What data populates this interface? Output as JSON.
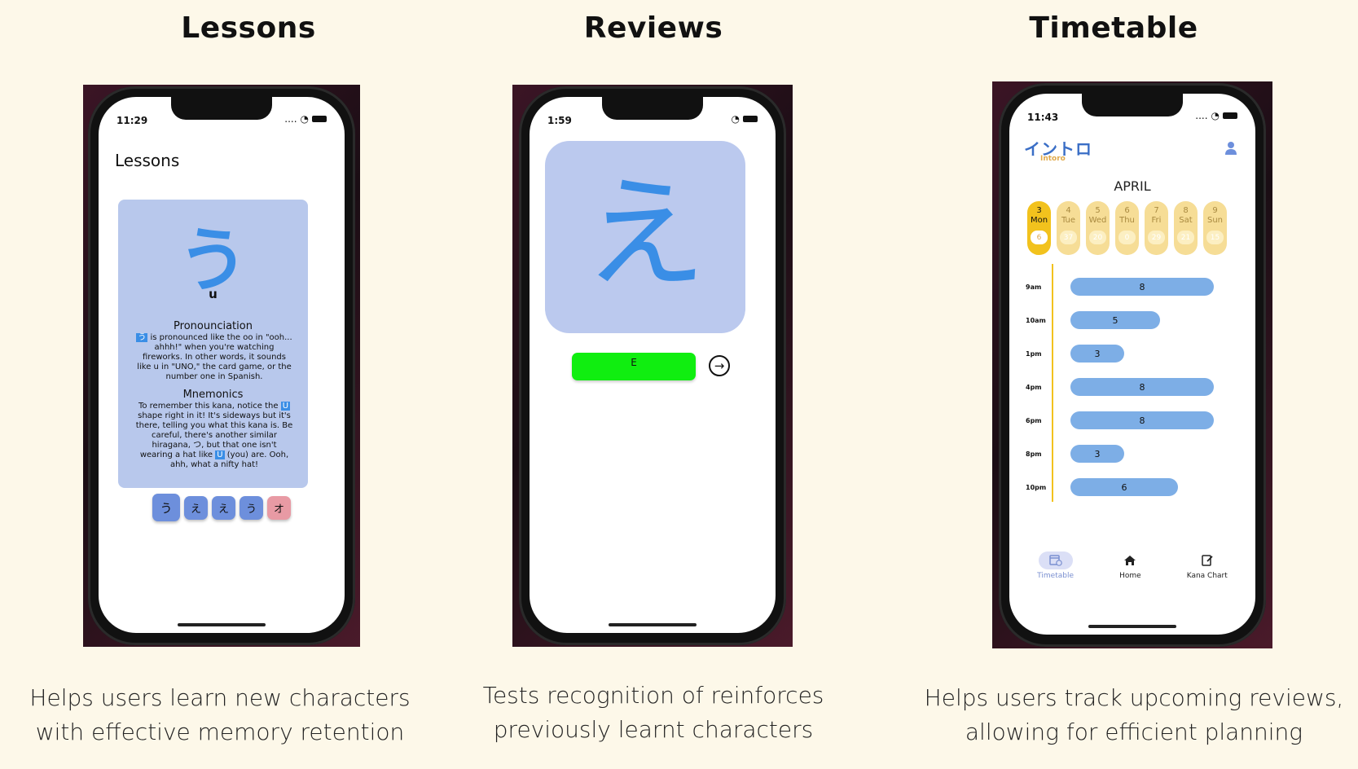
{
  "sections": [
    {
      "title": "Lessons",
      "caption_line1": "Helps users learn new characters",
      "caption_line2": "with effective memory retention"
    },
    {
      "title": "Reviews",
      "caption_line1": "Tests recognition of reinforces",
      "caption_line2": "previously learnt characters"
    },
    {
      "title": "Timetable",
      "caption_line1": "Helps users track upcoming reviews,",
      "caption_line2": "allowing for efficient planning"
    }
  ],
  "lessons": {
    "status_time": "11:29",
    "screen_title": "Lessons",
    "kana": "う",
    "romaji": "u",
    "pronunciation_heading": "Pronounciation",
    "pronunciation_text": "is pronounced like  the oo in \"ooh... ahhh!\" when you're watching fireworks. In other words, it sounds like u in \"UNO,\" the card game, or the number one in Spanish.",
    "mnemonics_heading": "Mnemonics",
    "mnemonics_text_1": "To remember this kana, notice the",
    "mnemonics_text_2": "shape right in it! It's sideways but it's there, telling you what this kana is. Be careful, there's another similar hiragana,",
    "mnemonics_text_3": ", but that one isn't wearing a hat like",
    "mnemonics_text_4": "(you) are. Ooh, ahh, what a nifty hat!",
    "hl_u": "U",
    "hl_tsu": "つ",
    "tiles": [
      "う",
      "え",
      "え",
      "う",
      "オ"
    ]
  },
  "reviews": {
    "status_time": "1:59",
    "kana": "え",
    "answer": "E"
  },
  "timetable": {
    "status_time": "11:43",
    "logo_jp": "イントロ",
    "logo_en": "Intoro",
    "month": "APRIL",
    "days": [
      {
        "num": "3",
        "name": "Mon",
        "count": "6"
      },
      {
        "num": "4",
        "name": "Tue",
        "count": "37"
      },
      {
        "num": "5",
        "name": "Wed",
        "count": "20"
      },
      {
        "num": "6",
        "name": "Thu",
        "count": "0"
      },
      {
        "num": "7",
        "name": "Fri",
        "count": "29"
      },
      {
        "num": "8",
        "name": "Sat",
        "count": "21"
      },
      {
        "num": "9",
        "name": "Sun",
        "count": "15"
      }
    ],
    "slots": [
      {
        "time": "9am",
        "count": "8"
      },
      {
        "time": "10am",
        "count": "5"
      },
      {
        "time": "1pm",
        "count": "3"
      },
      {
        "time": "4pm",
        "count": "8"
      },
      {
        "time": "6pm",
        "count": "8"
      },
      {
        "time": "8pm",
        "count": "3"
      },
      {
        "time": "10pm",
        "count": "6"
      }
    ],
    "nav": [
      "Timetable",
      "Home",
      "Kana Chart"
    ]
  },
  "colors": {
    "background": "#fdf8e9",
    "card_blue": "#b8c8ec",
    "kana_blue": "#3a8ee6",
    "answer_green": "#10ee10",
    "day_yellow": "#f2c21d"
  }
}
